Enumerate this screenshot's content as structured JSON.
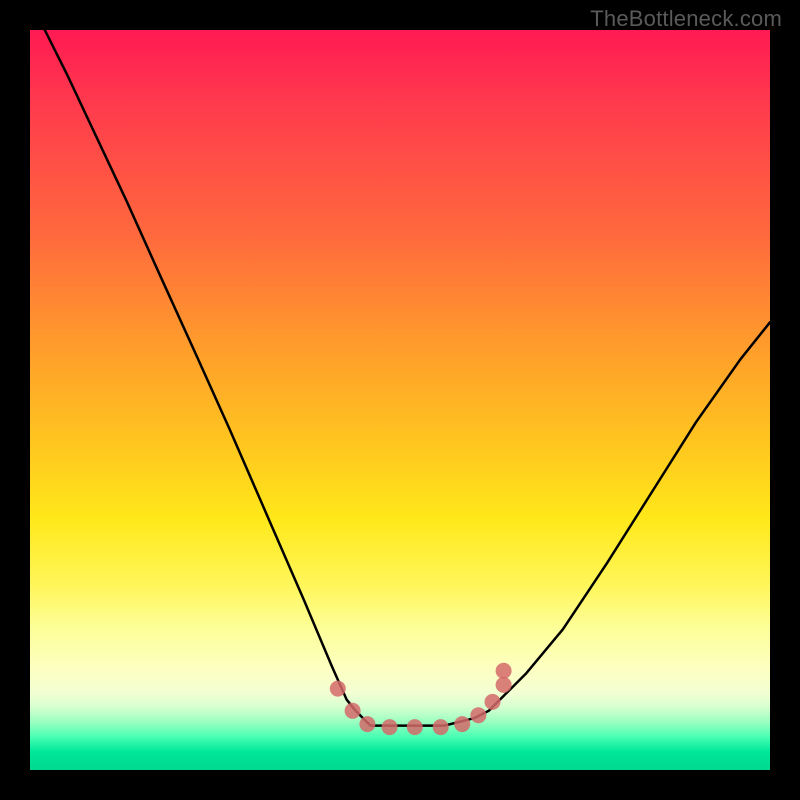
{
  "watermark": "TheBottleneck.com",
  "chart_data": {
    "type": "line",
    "title": "",
    "xlabel": "",
    "ylabel": "",
    "xlim": [
      0,
      1
    ],
    "ylim": [
      0,
      1
    ],
    "series": [
      {
        "name": "curve",
        "color": "#000000",
        "x": [
          0.02,
          0.05,
          0.09,
          0.13,
          0.175,
          0.225,
          0.27,
          0.32,
          0.37,
          0.408,
          0.428,
          0.44,
          0.46,
          0.51,
          0.56,
          0.6,
          0.62,
          0.645,
          0.67,
          0.72,
          0.78,
          0.84,
          0.9,
          0.96,
          1.0
        ],
        "y": [
          1.0,
          0.94,
          0.855,
          0.77,
          0.67,
          0.56,
          0.46,
          0.345,
          0.23,
          0.14,
          0.095,
          0.08,
          0.06,
          0.06,
          0.06,
          0.07,
          0.08,
          0.105,
          0.13,
          0.19,
          0.28,
          0.375,
          0.47,
          0.555,
          0.605
        ]
      }
    ],
    "markers": {
      "name": "dots",
      "color": "#d46a6a",
      "x": [
        0.416,
        0.436,
        0.456,
        0.486,
        0.52,
        0.555,
        0.584,
        0.606,
        0.625,
        0.64,
        0.64
      ],
      "y": [
        0.11,
        0.08,
        0.062,
        0.058,
        0.058,
        0.058,
        0.062,
        0.074,
        0.092,
        0.115,
        0.134
      ]
    },
    "background": {
      "type": "vertical-gradient",
      "stops": [
        {
          "pos": 0.0,
          "color": "#ff1a53"
        },
        {
          "pos": 0.28,
          "color": "#ff6a3d"
        },
        {
          "pos": 0.56,
          "color": "#ffc61f"
        },
        {
          "pos": 0.75,
          "color": "#fff65a"
        },
        {
          "pos": 0.9,
          "color": "#f3ffd2"
        },
        {
          "pos": 1.0,
          "color": "#00d88e"
        }
      ]
    }
  }
}
